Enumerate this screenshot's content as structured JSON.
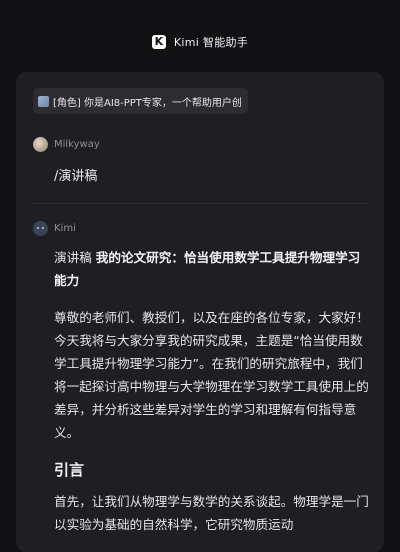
{
  "header": {
    "logo_letter": "K",
    "title": "Kimi 智能助手"
  },
  "conversation": {
    "role_chip": "[角色] 你是AI8-PPT专家，一个帮助用户创",
    "user": {
      "name": "Milkyway",
      "message": "/演讲稿"
    },
    "assistant": {
      "name": "Kimi",
      "title_prefix": "演讲稿 ",
      "title_bold": "我的论文研究：恰当使用数学工具提升物理学习能力",
      "paragraph1": "尊敬的老师们、教授们，以及在座的各位专家，大家好！今天我将与大家分享我的研究成果，主题是“恰当使用数学工具提升物理学习能力”。在我们的研究旅程中，我们将一起探讨高中物理与大学物理在学习数学工具使用上的差异，并分析这些差异对学生的学习和理解有何指导意义。",
      "heading": "引言",
      "paragraph2": "首先，让我们从物理学与数学的关系谈起。物理学是一门以实验为基础的自然科学，它研究物质运动"
    }
  },
  "colors": {
    "background": "#111113",
    "card": "#1f1f23",
    "chip": "#2c2c31",
    "text": "#e6e6ea",
    "muted": "#8e8e96"
  }
}
